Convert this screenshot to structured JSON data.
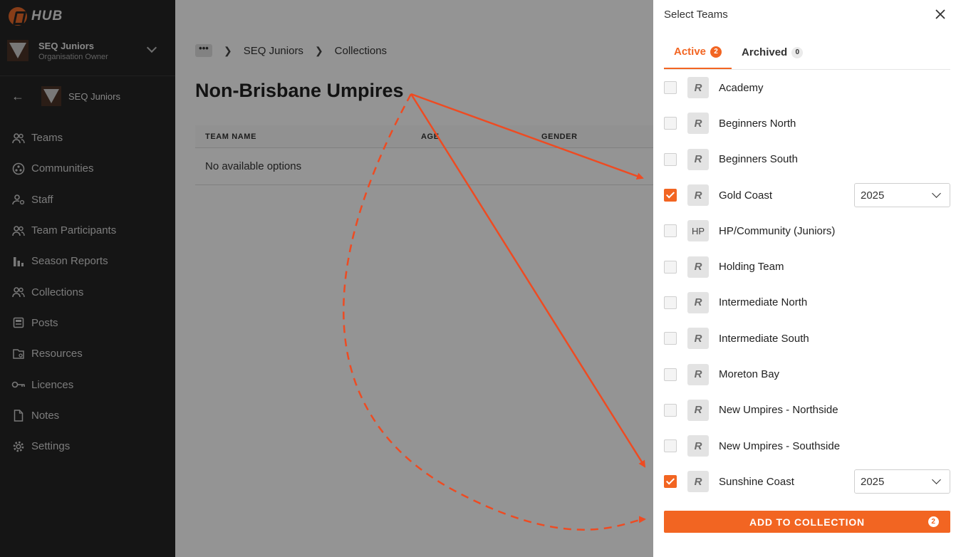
{
  "brand": {
    "name": "HUB",
    "accent": "#f26522"
  },
  "org": {
    "name": "SEQ Juniors",
    "role": "Organisation Owner"
  },
  "context": {
    "name": "SEQ Juniors"
  },
  "nav": [
    {
      "label": "Teams",
      "icon": "people-icon"
    },
    {
      "label": "Communities",
      "icon": "communities-icon"
    },
    {
      "label": "Staff",
      "icon": "staff-icon"
    },
    {
      "label": "Team Participants",
      "icon": "people-icon"
    },
    {
      "label": "Season Reports",
      "icon": "bar-chart-icon"
    },
    {
      "label": "Collections",
      "icon": "people-icon"
    },
    {
      "label": "Posts",
      "icon": "posts-icon"
    },
    {
      "label": "Resources",
      "icon": "resources-icon"
    },
    {
      "label": "Licences",
      "icon": "key-icon"
    },
    {
      "label": "Notes",
      "icon": "document-icon"
    },
    {
      "label": "Settings",
      "icon": "gear-icon"
    }
  ],
  "breadcrumb": {
    "more": "•••",
    "items": [
      "SEQ Juniors",
      "Collections"
    ]
  },
  "page": {
    "title": "Non-Brisbane Umpires",
    "columns": [
      "TEAM NAME",
      "AGE",
      "GENDER"
    ],
    "empty": "No available options"
  },
  "drawer": {
    "title": "Select Teams",
    "tabs": [
      {
        "label": "Active",
        "count": "2"
      },
      {
        "label": "Archived",
        "count": "0"
      }
    ],
    "teams": [
      {
        "name": "Academy",
        "logo": "R",
        "checked": false
      },
      {
        "name": "Beginners North",
        "logo": "R",
        "checked": false
      },
      {
        "name": "Beginners South",
        "logo": "R",
        "checked": false
      },
      {
        "name": "Gold Coast",
        "logo": "R",
        "checked": true,
        "season": "2025"
      },
      {
        "name": "HP/Community (Juniors)",
        "logo": "HP",
        "checked": false
      },
      {
        "name": "Holding Team",
        "logo": "R",
        "checked": false
      },
      {
        "name": "Intermediate North",
        "logo": "R",
        "checked": false
      },
      {
        "name": "Intermediate South",
        "logo": "R",
        "checked": false
      },
      {
        "name": "Moreton Bay",
        "logo": "R",
        "checked": false
      },
      {
        "name": "New Umpires - Northside",
        "logo": "R",
        "checked": false
      },
      {
        "name": "New Umpires - Southside",
        "logo": "R",
        "checked": false
      },
      {
        "name": "Sunshine Coast",
        "logo": "R",
        "checked": true,
        "season": "2025"
      }
    ],
    "add_button": {
      "label": "ADD TO COLLECTION",
      "count": "2"
    }
  }
}
